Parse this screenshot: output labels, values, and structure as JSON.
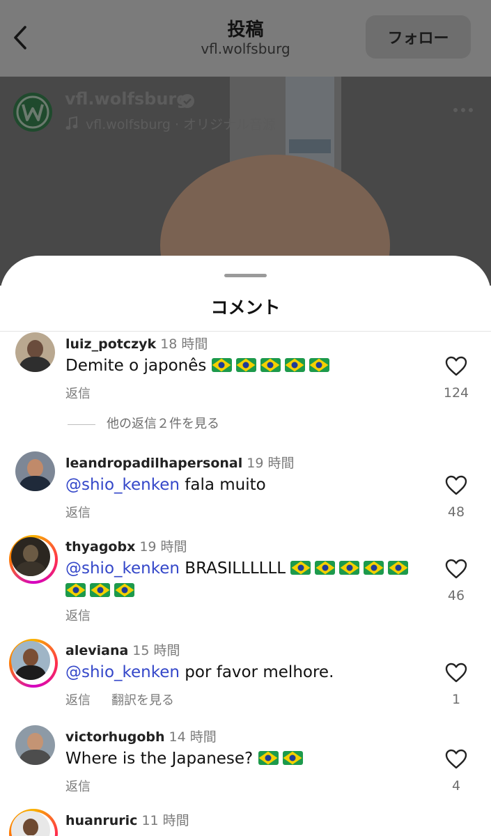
{
  "header": {
    "title": "投稿",
    "subtitle": "vfl.wolfsburg",
    "follow_label": "フォロー"
  },
  "post": {
    "account_name": "vfl.wolfsburg",
    "audio_label": "vfl.wolfsburg · オリジナル音源",
    "icons": [
      "back-icon",
      "verified-icon",
      "music-icon",
      "more-icon"
    ]
  },
  "comments_sheet": {
    "title": "コメント",
    "comments": [
      {
        "username": "luiz_potczyk",
        "time": "18 時間",
        "mention": "",
        "text": "Demite o japonês",
        "flags": 5,
        "reply_label": "返信",
        "translate_label": "",
        "likes": "124",
        "view_replies": "他の返信２件を見る",
        "story_ring": false
      },
      {
        "username": "leandropadilhapersonal",
        "time": "19 時間",
        "mention": "@shio_kenken",
        "text": " fala muito",
        "flags": 0,
        "reply_label": "返信",
        "translate_label": "",
        "likes": "48",
        "view_replies": "",
        "story_ring": false
      },
      {
        "username": "thyagobx",
        "time": "19 時間",
        "mention": "@shio_kenken",
        "text": " BRASILLLLLL",
        "flags": 8,
        "reply_label": "返信",
        "translate_label": "",
        "likes": "46",
        "view_replies": "",
        "story_ring": true
      },
      {
        "username": "aleviana",
        "time": "15 時間",
        "mention": "@shio_kenken",
        "text": " por favor melhore.",
        "flags": 0,
        "reply_label": "返信",
        "translate_label": "翻訳を見る",
        "likes": "1",
        "view_replies": "",
        "story_ring": true
      },
      {
        "username": "victorhugobh",
        "time": "14 時間",
        "mention": "",
        "text": "Where is the Japanese?",
        "flags": 2,
        "reply_label": "返信",
        "translate_label": "",
        "likes": "4",
        "view_replies": "",
        "story_ring": false
      },
      {
        "username": "huanruric",
        "time": "11 時間",
        "mention": "",
        "text": "",
        "flags": 0,
        "reply_label": "",
        "translate_label": "",
        "likes": "",
        "view_replies": "",
        "story_ring": true
      }
    ]
  },
  "colors": {
    "mention": "#3447c9",
    "wolfsburg_green": "#1f6b3b",
    "like_heart_outline": "#222222"
  }
}
